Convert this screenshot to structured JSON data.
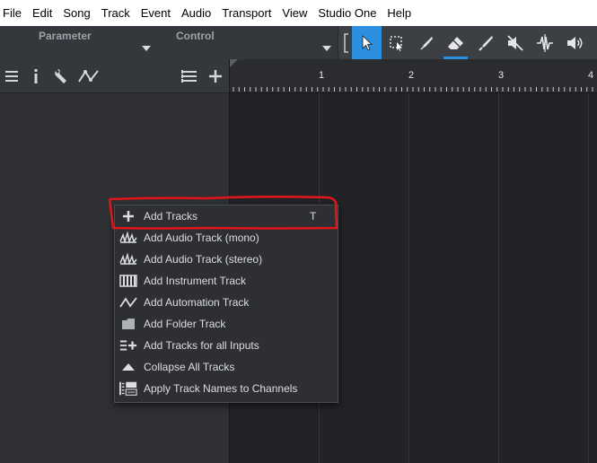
{
  "menu": [
    "File",
    "Edit",
    "Song",
    "Track",
    "Event",
    "Audio",
    "Transport",
    "View",
    "Studio One",
    "Help"
  ],
  "inspector": {
    "parameter_label": "Parameter",
    "control_label": "Control"
  },
  "tools": [
    {
      "name": "arrow-tool-icon",
      "active": true
    },
    {
      "name": "range-tool-icon",
      "active": false
    },
    {
      "name": "split-tool-icon",
      "active": false
    },
    {
      "name": "eraser-tool-icon",
      "active": false
    },
    {
      "name": "paint-tool-icon",
      "active": false
    },
    {
      "name": "mute-tool-icon",
      "active": false
    },
    {
      "name": "bend-tool-icon",
      "active": false
    },
    {
      "name": "listen-tool-icon",
      "active": false
    }
  ],
  "ruler": {
    "bars": [
      "1",
      "2",
      "3",
      "4"
    ]
  },
  "context_menu": {
    "items": [
      {
        "label": "Add Tracks",
        "shortcut": "T",
        "icon": "plus-icon"
      },
      {
        "label": "Add Audio Track (mono)",
        "shortcut": "",
        "icon": "waveform-icon"
      },
      {
        "label": "Add Audio Track (stereo)",
        "shortcut": "",
        "icon": "waveform-icon"
      },
      {
        "label": "Add Instrument Track",
        "shortcut": "",
        "icon": "keyboard-icon"
      },
      {
        "label": "Add Automation Track",
        "shortcut": "",
        "icon": "automation-icon"
      },
      {
        "label": "Add Folder Track",
        "shortcut": "",
        "icon": "folder-icon"
      },
      {
        "label": "Add Tracks for all Inputs",
        "shortcut": "",
        "icon": "list-plus-icon"
      },
      {
        "label": "Collapse All Tracks",
        "shortcut": "",
        "icon": "collapse-icon"
      },
      {
        "label": "Apply Track Names to Channels",
        "shortcut": "",
        "icon": "apply-names-icon"
      }
    ]
  },
  "colors": {
    "accent": "#2d8fe0",
    "highlight_annotation": "#e0161b"
  }
}
